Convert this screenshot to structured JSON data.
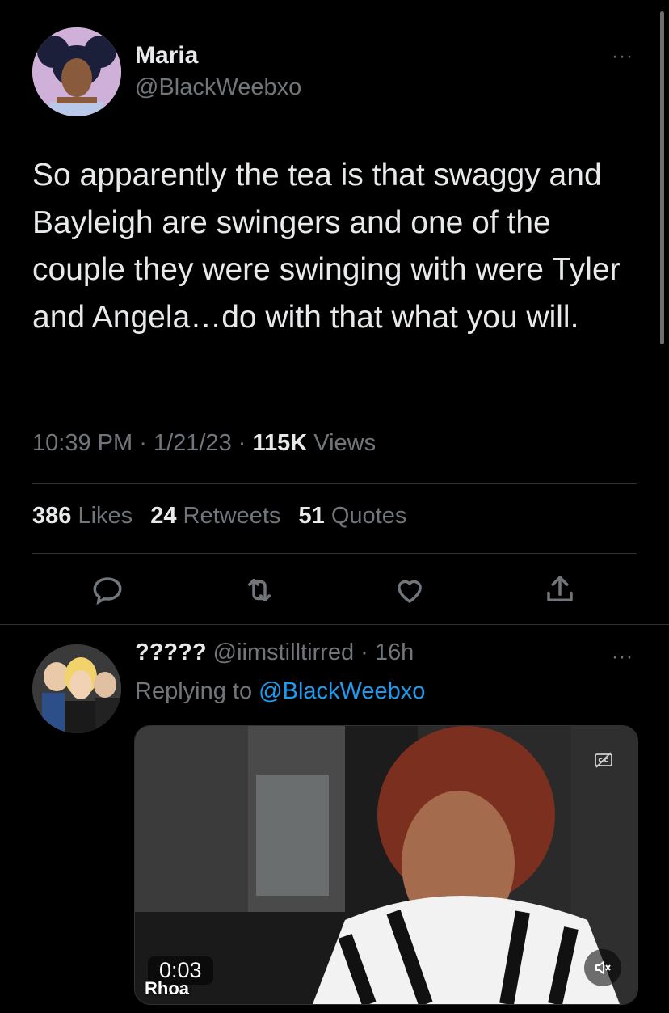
{
  "tweet": {
    "author_name": "Maria",
    "author_handle": "@BlackWeebxo",
    "text": "So apparently the tea is that swaggy and Bayleigh are swingers and one of the couple they were swinging with were Tyler and Angela…do with that what you will.",
    "time": "10:39 PM",
    "sep1": "·",
    "date": "1/21/23",
    "sep2": "·",
    "views_count": "115K",
    "views_label": "Views",
    "likes_count": "386",
    "likes_label": "Likes",
    "retweets_count": "24",
    "retweets_label": "Retweets",
    "quotes_count": "51",
    "quotes_label": "Quotes",
    "more_label": "···"
  },
  "reply": {
    "author_name": "?????",
    "author_handle": "@iimstilltirred",
    "separator": "·",
    "age": "16h",
    "replying_prefix": "Replying to",
    "replying_handle": "@BlackWeebxo",
    "more_label": "···",
    "video": {
      "timestamp": "0:03",
      "caption": "Rhoa"
    }
  },
  "icons": {
    "reply": "reply-icon",
    "retweet": "retweet-icon",
    "like": "heart-icon",
    "share": "share-icon",
    "captions": "closed-captions-off-icon",
    "mute": "mute-icon"
  },
  "colors": {
    "background": "#000000",
    "text": "#e7e9ea",
    "secondary": "#71767b",
    "link": "#1d9bf0",
    "divider": "#2f3336"
  }
}
